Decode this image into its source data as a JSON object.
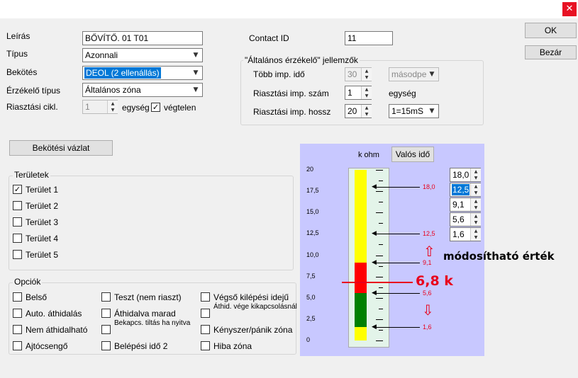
{
  "window": {
    "close_glyph": "✕"
  },
  "form": {
    "leiras_label": "Leírás",
    "leiras_value": "BŐVÍTŐ. 01 T01",
    "tipus_label": "Típus",
    "tipus_value": "Azonnali",
    "bekotes_label": "Bekötés",
    "bekotes_value": "DEOL (2 ellenállás)",
    "erzekelo_label": "Érzékelő típus",
    "erzekelo_value": "Általános zóna",
    "riasztasi_cikl_label": "Riasztási cikl.",
    "riasztasi_cikl_value": "1",
    "egyseg_label": "egység",
    "vegtelen_label": "végtelen",
    "vegtelen_checked": true,
    "contact_id_label": "Contact ID",
    "contact_id_value": "11"
  },
  "sensor": {
    "title": "\"Általános érzékelő\" jellemzők",
    "tobb_imp_label": "Több imp. idő",
    "tobb_imp_value": "30",
    "tobb_imp_unit": "másodpe",
    "imp_szam_label": "Riasztási imp. szám",
    "imp_szam_value": "1",
    "imp_szam_unit": "egység",
    "imp_hossz_label": "Riasztási imp. hossz",
    "imp_hossz_value": "20",
    "imp_hossz_unit": "1=15mS"
  },
  "buttons": {
    "ok": "OK",
    "bezar": "Bezár",
    "bekotesi_vazlat": "Bekötési vázlat",
    "valos_ido": "Valós idő"
  },
  "teruletek": {
    "title": "Területek",
    "items": [
      {
        "label": "Terület 1",
        "checked": true
      },
      {
        "label": "Terület 2",
        "checked": false
      },
      {
        "label": "Terület 3",
        "checked": false
      },
      {
        "label": "Terület 4",
        "checked": false
      },
      {
        "label": "Terület 5",
        "checked": false
      }
    ]
  },
  "opciok": {
    "title": "Opciók",
    "items": [
      {
        "label": "Belső"
      },
      {
        "label": "Teszt (nem riaszt)"
      },
      {
        "label": "Végső kilépési idejű"
      },
      {
        "label": "Auto. áthidalás"
      },
      {
        "label": "Áthidalva marad"
      },
      {
        "label": "Áthid. vége kikapcsolásnál"
      },
      {
        "label": "Nem áthidalható"
      },
      {
        "label": "Bekapcs. tiltás ha nyitva"
      },
      {
        "label": "Kényszer/pánik zóna"
      },
      {
        "label": "Ajtócsengő"
      },
      {
        "label": "Belépési idő 2"
      },
      {
        "label": "Hiba zóna"
      }
    ]
  },
  "gauge": {
    "unit_label": "k ohm",
    "axis_ticks": [
      "20",
      "17,5",
      "15,0",
      "12,5",
      "10,0",
      "7,5",
      "5,0",
      "2,5",
      "0"
    ],
    "threshold_labels": [
      "18,0",
      "12,5",
      "9,1",
      "5,6",
      "1,6"
    ],
    "threshold_values": [
      18.0,
      12.5,
      9.1,
      5.6,
      1.6
    ],
    "current_value": 6.8,
    "current_label": "6,8 k",
    "annotation": "módosítható érték",
    "spin_values": [
      "18,0",
      "12,5",
      "9,1",
      "5,6",
      "1,6"
    ],
    "colors": {
      "yellow": "#ffff00",
      "red": "#ff0000",
      "green": "#008000",
      "annotation_red": "#e8001c",
      "background": "#c8c8ff"
    }
  }
}
